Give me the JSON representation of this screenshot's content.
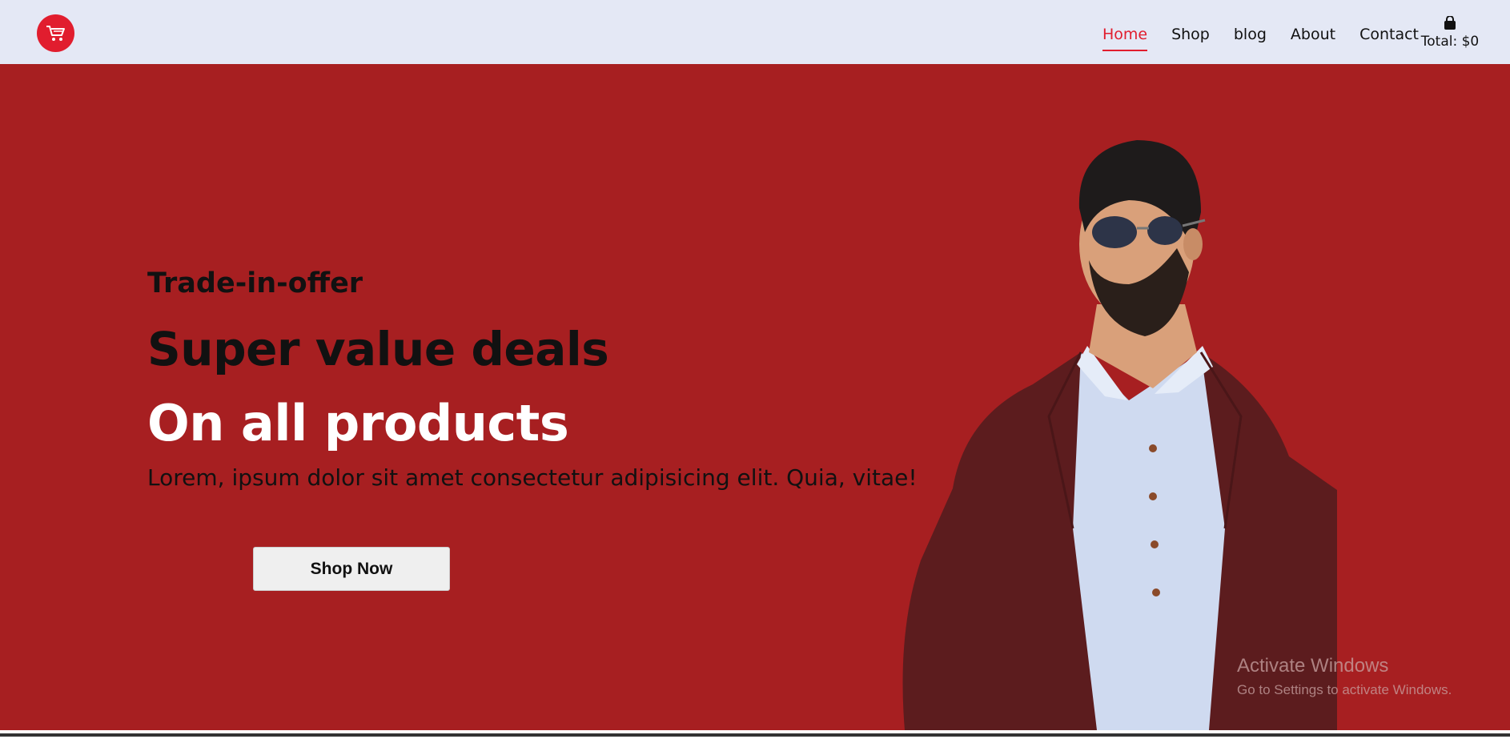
{
  "nav": {
    "items": [
      {
        "label": "Home",
        "active": true
      },
      {
        "label": "Shop",
        "active": false
      },
      {
        "label": "blog",
        "active": false
      },
      {
        "label": "About",
        "active": false
      },
      {
        "label": "Contact",
        "active": false
      }
    ],
    "cart_total": "Total: $0"
  },
  "hero": {
    "pretitle": "Trade-in-offer",
    "title_line1": "Super value deals",
    "title_line2": "On all products",
    "description": "Lorem, ipsum dolor sit amet consectetur adipisicing elit. Quia, vitae!",
    "button_label": "Shop Now"
  },
  "watermark": {
    "title": "Activate Windows",
    "subtitle": "Go to Settings to activate Windows."
  },
  "colors": {
    "accent": "#e11d2e",
    "hero_bg": "#a71f21",
    "nav_bg": "#e4e8f5"
  },
  "icons": {
    "logo": "shopping-cart-icon",
    "cart": "shopping-bag-icon"
  }
}
